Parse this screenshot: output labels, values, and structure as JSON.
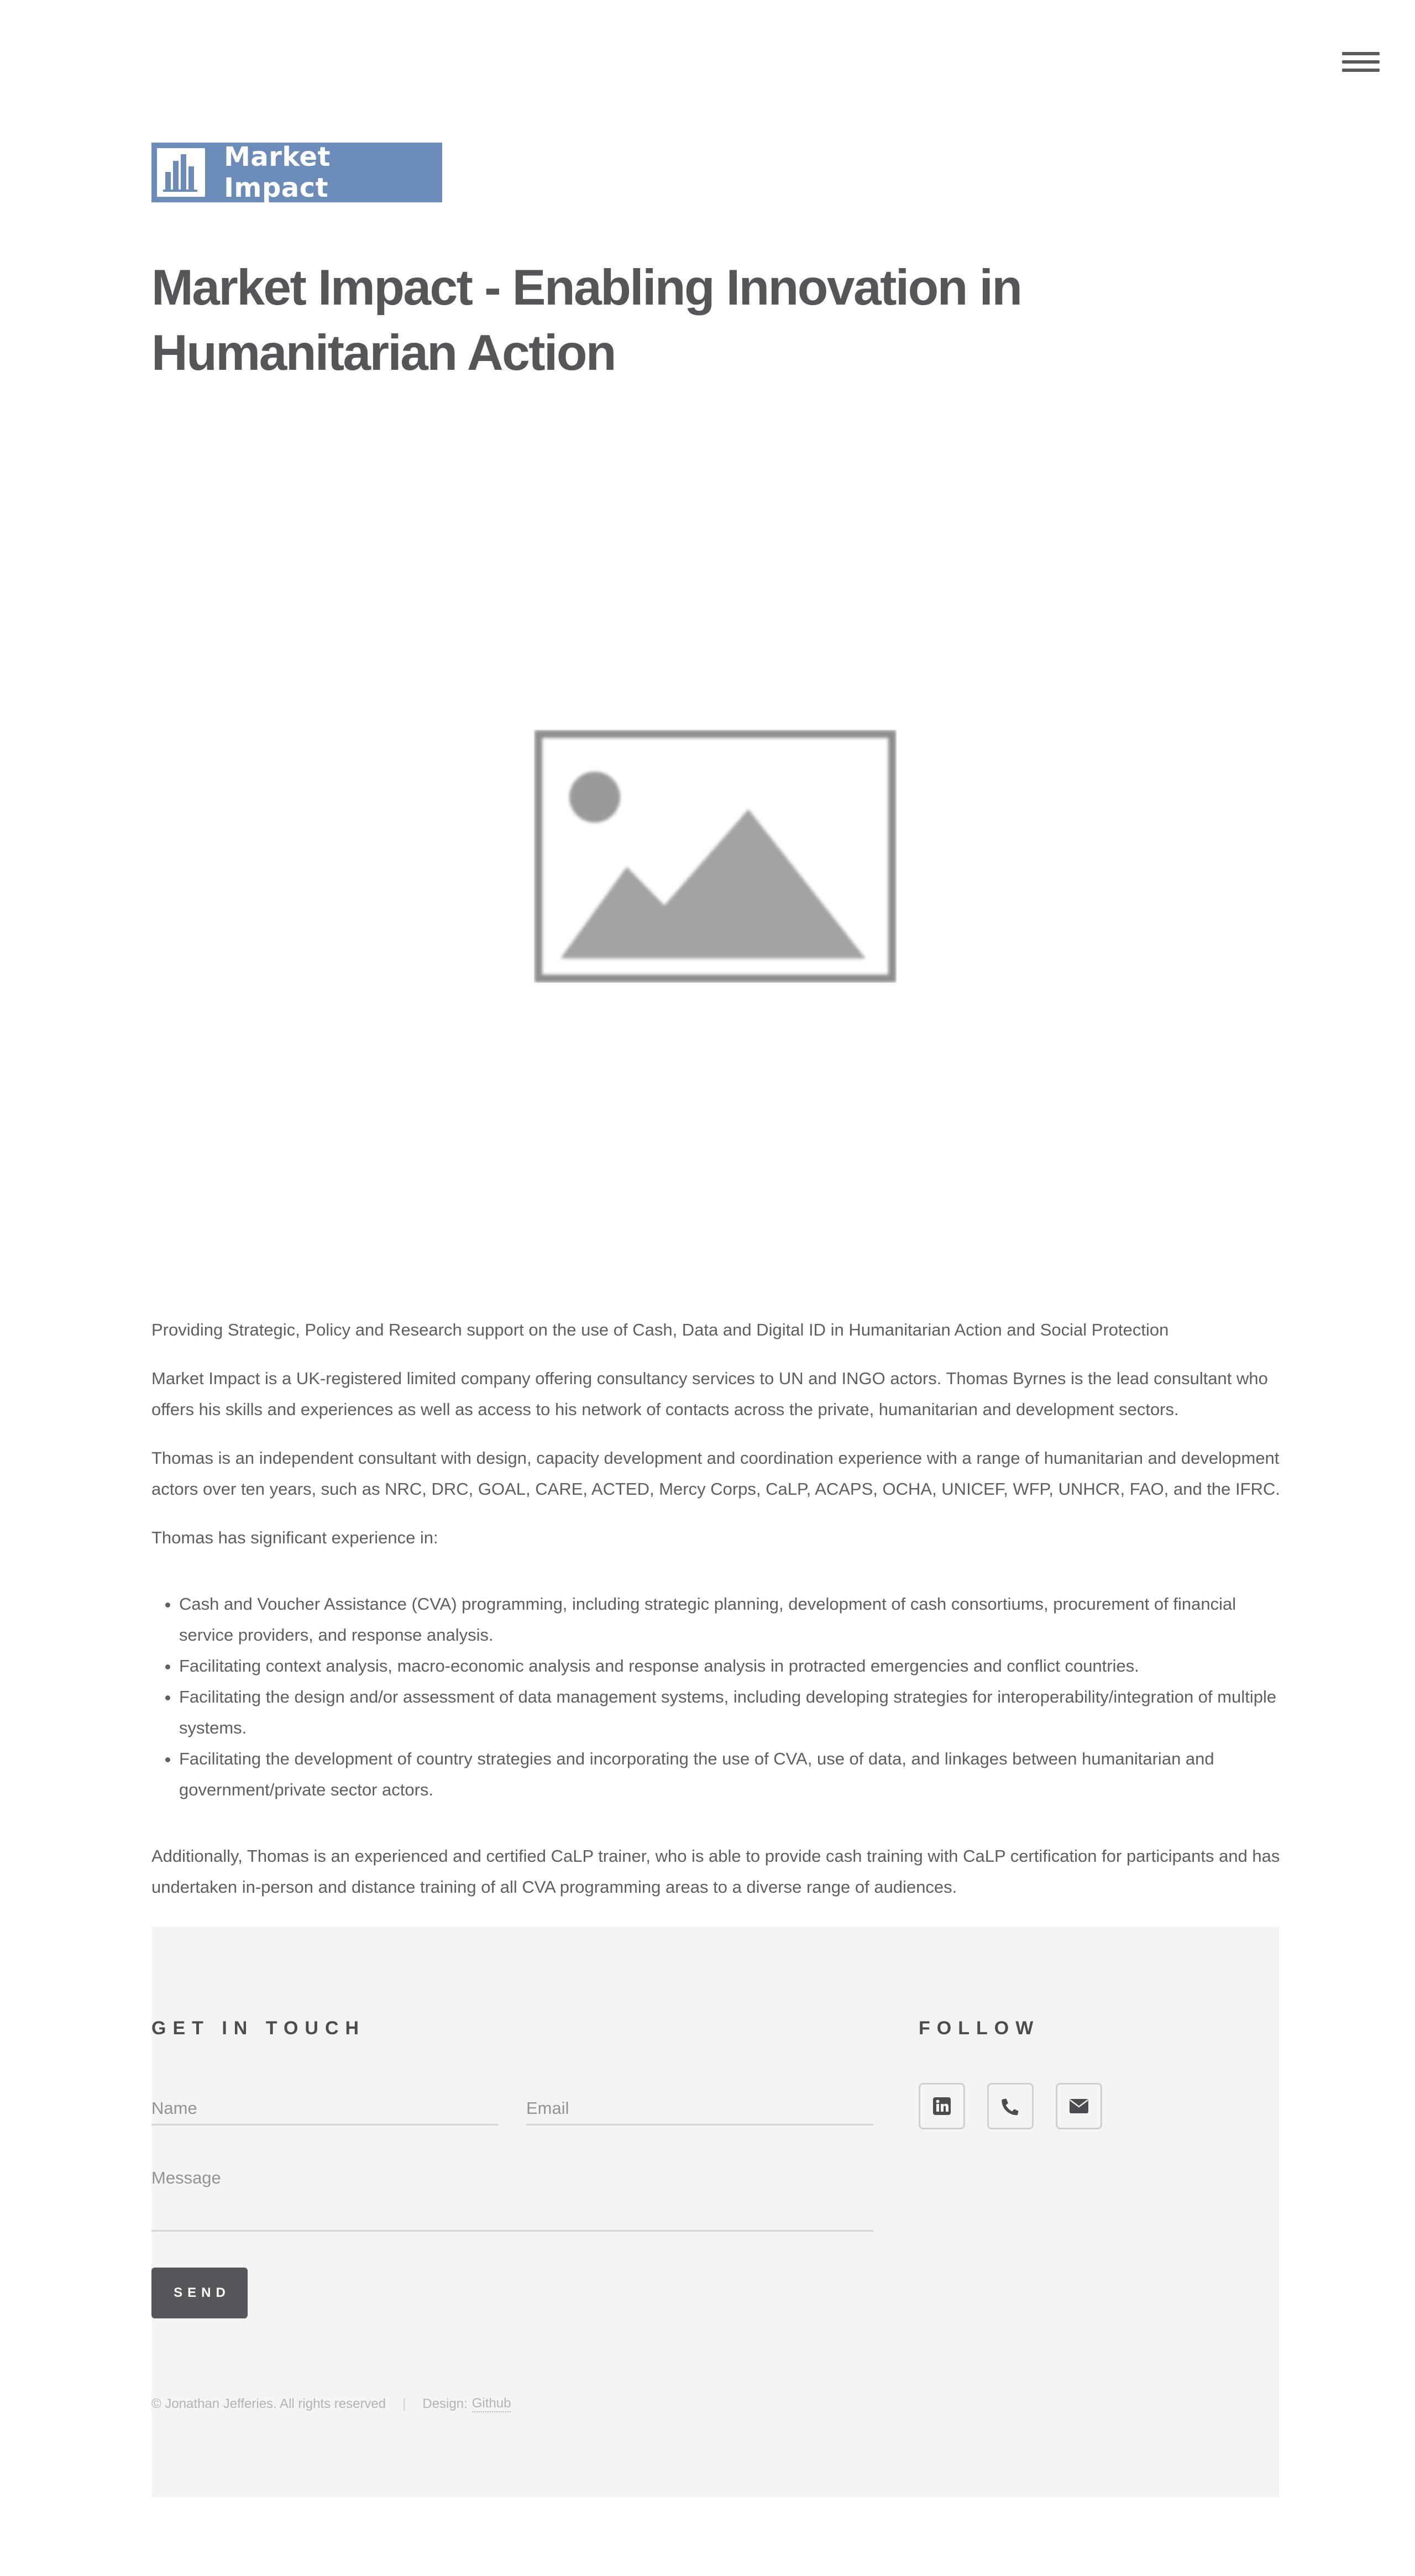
{
  "header": {
    "menu_icon": "hamburger-menu-icon",
    "logo_icon": "bar-chart-logo-icon",
    "logo_text": "Market Impact"
  },
  "main": {
    "title": "Market Impact - Enabling Innovation in Humanitarian Action",
    "image_icon": "image-placeholder-icon",
    "intro": "Providing Strategic, Policy and Research support on the use of Cash, Data and Digital ID in Humanitarian Action and Social Protection",
    "paragraph_1": "Market Impact is a UK-registered limited company offering consultancy services to UN and INGO actors. Thomas Byrnes is the lead consultant who offers his skills and experiences as well as access to his network of contacts across the private, humanitarian and development sectors.",
    "paragraph_2": "Thomas is an independent consultant with design, capacity development and coordination experience with a range of humanitarian and development actors over ten years, such as NRC, DRC, GOAL, CARE, ACTED, Mercy Corps, CaLP, ACAPS, OCHA, UNICEF, WFP, UNHCR, FAO, and the IFRC.",
    "experience_intro": "Thomas has significant experience in:",
    "experience": [
      "Cash and Voucher Assistance (CVA) programming, including strategic planning, development of cash consortiums, procurement of financial service providers, and response analysis.",
      "Facilitating context analysis, macro-economic analysis and response analysis in protracted emergencies and conflict countries.",
      "Facilitating the design and/or assessment of data management systems, including developing strategies for interoperability/integration of multiple systems.",
      "Facilitating the development of country strategies and incorporating the use of CVA, use of data, and linkages between humanitarian and government/private sector actors."
    ],
    "closing": "Additionally, Thomas is an experienced and certified CaLP trainer, who is able to provide cash training with CaLP certification for participants and has undertaken in-person and distance training of all CVA programming areas to a diverse range of audiences."
  },
  "footer": {
    "contact_heading": "GET IN TOUCH",
    "name_placeholder": "Name",
    "email_placeholder": "Email",
    "message_placeholder": "Message",
    "send_label": "SEND",
    "follow_heading": "FOLLOW",
    "social": [
      {
        "icon": "linkedin-icon"
      },
      {
        "icon": "phone-icon"
      },
      {
        "icon": "envelope-icon"
      }
    ],
    "copyright": "© Jonathan Jefferies. All rights reserved",
    "separator": "|",
    "design_label": "Design:",
    "design_link": "Github"
  },
  "colors": {
    "logo_bg": "#6b8cb8",
    "text": "#5c5f63",
    "title": "#545659",
    "footer_bg": "#f4f4f4",
    "button_bg": "#545659"
  }
}
